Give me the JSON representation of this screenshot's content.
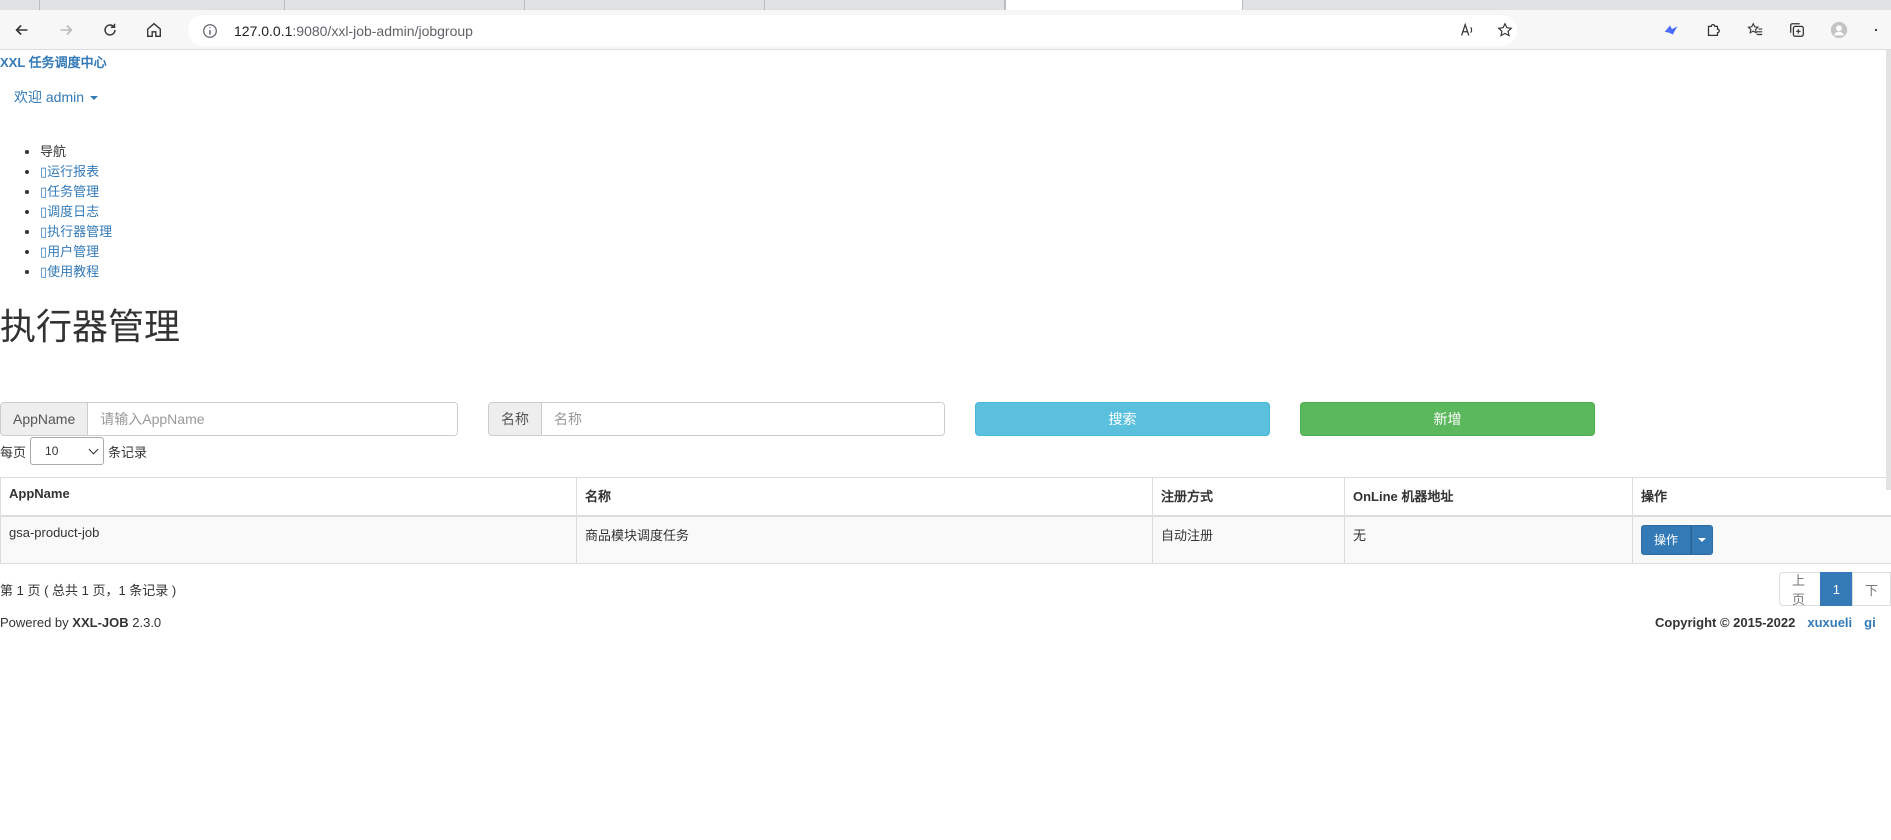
{
  "browser": {
    "url_host": "127.0.0.1",
    "url_rest": ":9080/xxl-job-admin/jobgroup"
  },
  "header": {
    "brand": "XXL 任务调度中心",
    "welcome": "欢迎 admin"
  },
  "nav": {
    "heading": "导航",
    "items": [
      {
        "label": "运行报表"
      },
      {
        "label": "任务管理"
      },
      {
        "label": "调度日志"
      },
      {
        "label": "执行器管理"
      },
      {
        "label": "用户管理"
      },
      {
        "label": "使用教程"
      }
    ]
  },
  "main": {
    "title": "执行器管理",
    "search": {
      "appname_addon": "AppName",
      "appname_placeholder": "请输入AppName",
      "name_addon": "名称",
      "name_placeholder": "名称",
      "search_label": "搜索",
      "add_label": "新增"
    },
    "length": {
      "prefix": "每页",
      "value": "10",
      "suffix": "条记录"
    },
    "table": {
      "headers": [
        "AppName",
        "名称",
        "注册方式",
        "OnLine 机器地址",
        "操作"
      ],
      "rows": [
        {
          "appname": "gsa-product-job",
          "name": "商品模块调度任务",
          "reg": "自动注册",
          "online": "无",
          "action": "操作"
        }
      ]
    },
    "info": "第 1 页 ( 总共 1 页，1 条记录 )",
    "pager": {
      "prev": "上页",
      "current": "1",
      "next": "下"
    }
  },
  "footer": {
    "powered_prefix": "Powered by",
    "product": "XXL-JOB",
    "version": "2.3.0",
    "copyright": "Copyright © 2015-2022",
    "author": "xuxueli",
    "link": "gi"
  }
}
